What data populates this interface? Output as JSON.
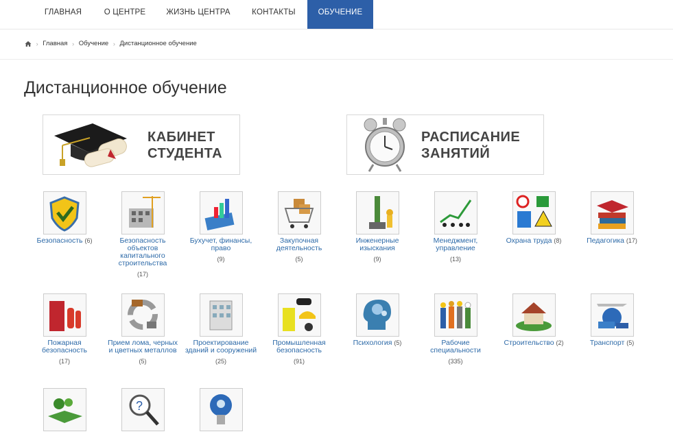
{
  "nav": {
    "items": [
      {
        "label": "ГЛАВНАЯ"
      },
      {
        "label": "О ЦЕНТРЕ"
      },
      {
        "label": "ЖИЗНЬ ЦЕНТРА"
      },
      {
        "label": "КОНТАКТЫ"
      },
      {
        "label": "ОБУЧЕНИЕ"
      }
    ],
    "active_color": "#2d5fa8"
  },
  "breadcrumb": {
    "items": [
      "Главная",
      "Обучение",
      "Дистанционное обучение"
    ],
    "home_icon": "home-icon"
  },
  "page_title": "Дистанционное обучение",
  "banners": [
    {
      "line1": "КАБИНЕТ",
      "line2": "СТУДЕНТА",
      "icon": "graduation-cap-icon"
    },
    {
      "line1": "РАСПИСАНИЕ",
      "line2": "ЗАНЯТИЙ",
      "icon": "alarm-clock-icon"
    }
  ],
  "categories": [
    {
      "label": "Безопасность",
      "count": "(6)",
      "icon": "shield-check-icon"
    },
    {
      "label": "Безопасность объектов капитального строительства",
      "count": "(17)",
      "icon": "construction-site-icon"
    },
    {
      "label": "Бухучет, финансы, право",
      "count": "(9)",
      "icon": "finance-chart-icon"
    },
    {
      "label": "Закупочная деятельность",
      "count": "(5)",
      "icon": "shopping-cart-icon"
    },
    {
      "label": "Инженерные изыскания",
      "count": "(9)",
      "icon": "survey-engineer-icon"
    },
    {
      "label": "Менеджмент, управление",
      "count": "(13)",
      "icon": "management-growth-icon"
    },
    {
      "label": "Охрана труда",
      "count": "(8)",
      "icon": "safety-signs-icon"
    },
    {
      "label": "Педагогика",
      "count": "(17)",
      "icon": "books-cap-icon"
    },
    {
      "label": "Пожарная безопасность",
      "count": "(17)",
      "icon": "fire-extinguisher-icon"
    },
    {
      "label": "Прием лома, черных и цветных металлов",
      "count": "(5)",
      "icon": "scrap-metal-icon"
    },
    {
      "label": "Проектирование зданий и сооружений",
      "count": "(25)",
      "icon": "building-design-icon"
    },
    {
      "label": "Промышленная безопасность",
      "count": "(91)",
      "icon": "hardhat-gear-icon"
    },
    {
      "label": "Психология",
      "count": "(5)",
      "icon": "brain-head-icon"
    },
    {
      "label": "Рабочие специальности",
      "count": "(335)",
      "icon": "workers-group-icon"
    },
    {
      "label": "Строительство",
      "count": "(2)",
      "icon": "house-icon"
    },
    {
      "label": "Транспорт",
      "count": "(5)",
      "icon": "transport-icon"
    },
    {
      "label": "",
      "count": "",
      "icon": "ecology-book-icon"
    },
    {
      "label": "",
      "count": "",
      "icon": "magnifier-question-icon"
    },
    {
      "label": "",
      "count": "",
      "icon": "lightbulb-icon"
    }
  ]
}
